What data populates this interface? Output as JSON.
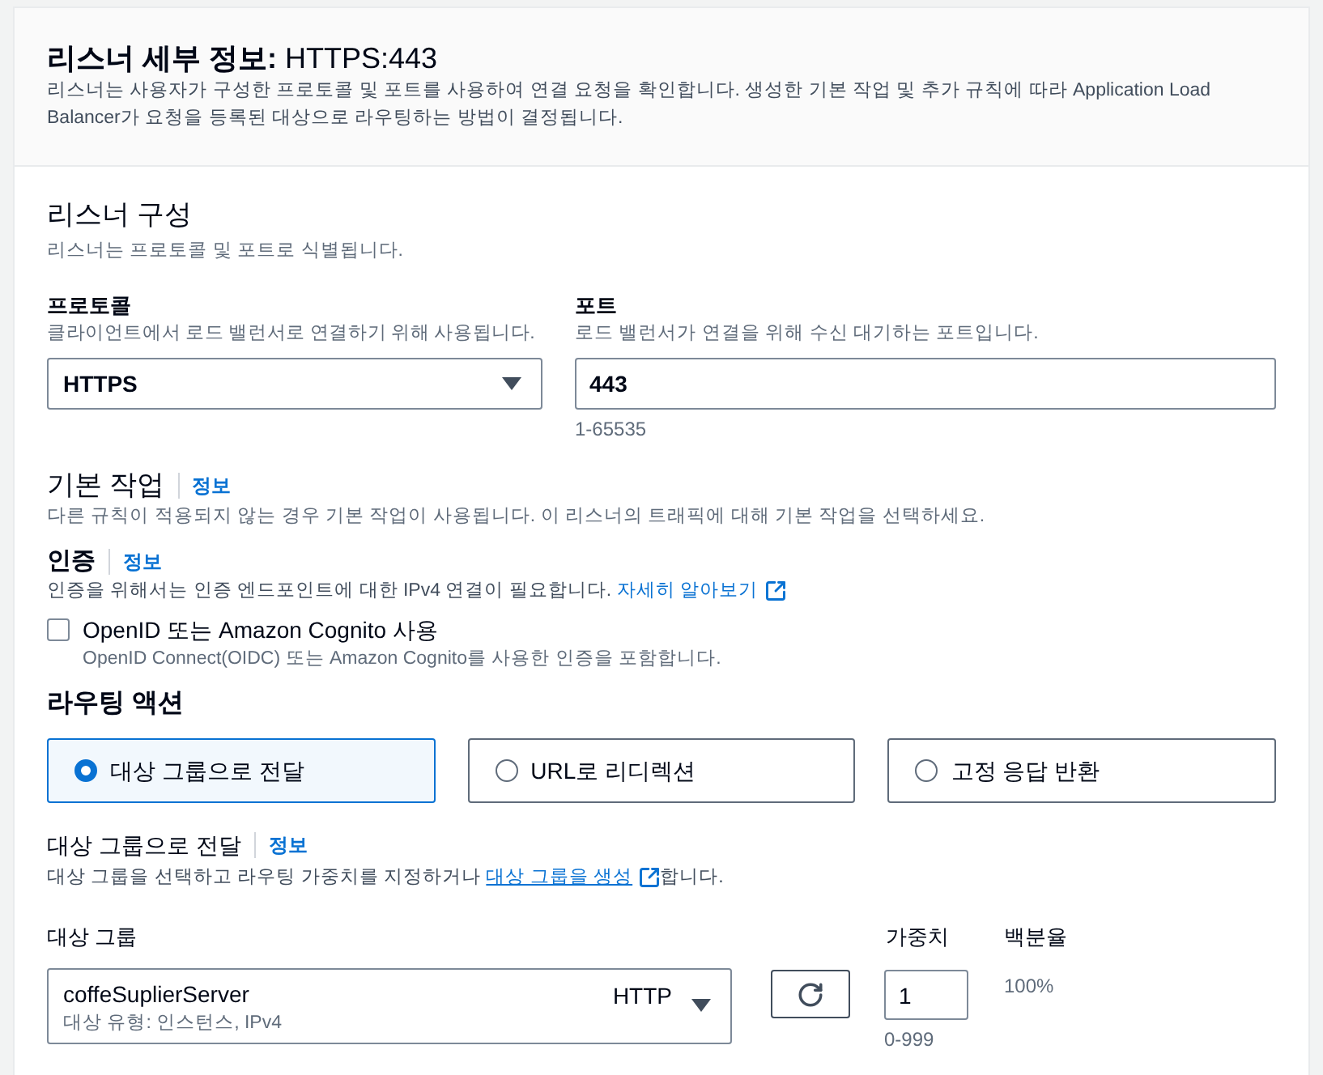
{
  "header": {
    "title": "**리스너 세부 정보:** HTTPS:443",
    "description": "리스너는 사용자가 구성한 프로토콜 및 포트를 사용하여 연결 요청을 확인합니다. 생성한 기본 작업 및 추가 규칙에 따라 Application Load Balancer가 요청을 등록된 대상으로 라우팅하는 방법이 결정됩니다."
  },
  "listener_config": {
    "title": "리스너 구성",
    "description": "리스너는 프로토콜 및 포트로 식별됩니다.",
    "protocol": {
      "label": "프로토콜",
      "description": "클라이언트에서 로드 밸런서로 연결하기 위해 사용됩니다.",
      "value": "HTTPS"
    },
    "port": {
      "label": "포트",
      "description": "로드 밸런서가 연결을 위해 수신 대기하는 포트입니다.",
      "value": "443",
      "constraint": "1-65535"
    }
  },
  "default_action": {
    "title": "기본 작업",
    "info_link": "정보",
    "description": "다른 규칙이 적용되지 않는 경우 기본 작업이 사용됩니다. 이 리스너의 트래픽에 대해 기본 작업을 선택하세요."
  },
  "authentication": {
    "title": "인증",
    "info_link": "정보",
    "description": "인증을 위해서는 인증 엔드포인트에 대한 IPv4 연결이 필요합니다.",
    "learn_more_link": "자세히 알아보기",
    "option": {
      "label": "OpenID 또는 Amazon Cognito 사용",
      "description": "OpenID Connect(OIDC) 또는 Amazon Cognito를 사용한 인증을 포함합니다.",
      "checked": false
    }
  },
  "routing_action": {
    "title": "라우팅 액션",
    "options": [
      {
        "label": "대상 그룹으로 전달",
        "selected": true
      },
      {
        "label": "URL로 리디렉션",
        "selected": false
      },
      {
        "label": "고정 응답 반환",
        "selected": false
      }
    ]
  },
  "forward": {
    "title": "대상 그룹으로 전달",
    "info_link": "정보",
    "description_before": "대상 그룹을 선택하고 라우팅 가중치를 지정하거나",
    "create_link": "대상 그룹을 생성",
    "description_after": "합니다.",
    "columns": {
      "target_group": "대상 그룹",
      "weight": "가중치",
      "percentage": "백분율"
    },
    "rows": [
      {
        "name": "coffeSuplierServer",
        "protocol": "HTTP",
        "type": "대상 유형: 인스턴스, IPv4",
        "weight": "1",
        "weight_constraint": "0-999",
        "percentage": "100%"
      }
    ]
  }
}
